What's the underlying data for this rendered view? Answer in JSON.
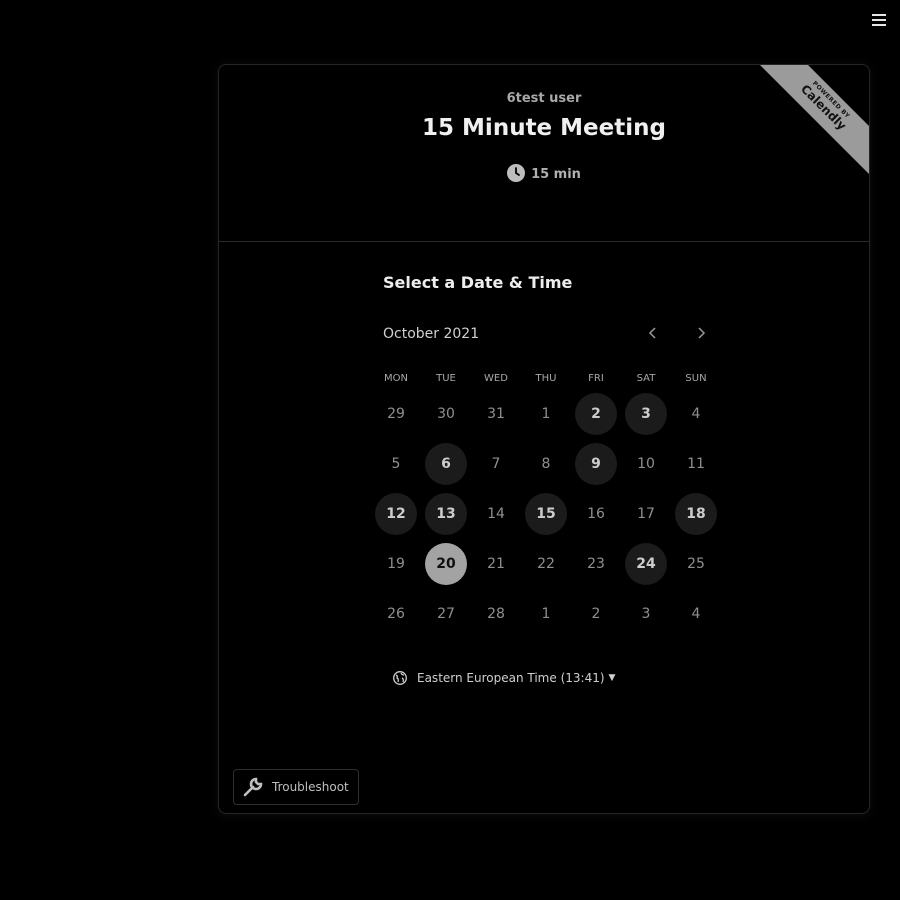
{
  "badge": {
    "powered_by": "POWERED BY",
    "brand": "Calendly"
  },
  "header": {
    "organizer": "6test user",
    "event_name": "15 Minute Meeting",
    "duration": "15 min"
  },
  "calendar": {
    "section_title": "Select a Date & Time",
    "month_label": "October 2021",
    "weekdays": [
      "MON",
      "TUE",
      "WED",
      "THU",
      "FRI",
      "SAT",
      "SUN"
    ],
    "weeks": [
      [
        {
          "day": "29",
          "state": "disabled"
        },
        {
          "day": "30",
          "state": "disabled"
        },
        {
          "day": "31",
          "state": "disabled"
        },
        {
          "day": "1",
          "state": "disabled"
        },
        {
          "day": "2",
          "state": "available"
        },
        {
          "day": "3",
          "state": "available"
        },
        {
          "day": "4",
          "state": "disabled"
        }
      ],
      [
        {
          "day": "5",
          "state": "disabled"
        },
        {
          "day": "6",
          "state": "available"
        },
        {
          "day": "7",
          "state": "disabled"
        },
        {
          "day": "8",
          "state": "disabled"
        },
        {
          "day": "9",
          "state": "available"
        },
        {
          "day": "10",
          "state": "disabled"
        },
        {
          "day": "11",
          "state": "disabled"
        }
      ],
      [
        {
          "day": "12",
          "state": "available"
        },
        {
          "day": "13",
          "state": "available"
        },
        {
          "day": "14",
          "state": "disabled"
        },
        {
          "day": "15",
          "state": "available"
        },
        {
          "day": "16",
          "state": "disabled"
        },
        {
          "day": "17",
          "state": "disabled"
        },
        {
          "day": "18",
          "state": "available"
        }
      ],
      [
        {
          "day": "19",
          "state": "disabled"
        },
        {
          "day": "20",
          "state": "selected"
        },
        {
          "day": "21",
          "state": "disabled"
        },
        {
          "day": "22",
          "state": "disabled"
        },
        {
          "day": "23",
          "state": "disabled"
        },
        {
          "day": "24",
          "state": "available"
        },
        {
          "day": "25",
          "state": "disabled"
        }
      ],
      [
        {
          "day": "26",
          "state": "disabled"
        },
        {
          "day": "27",
          "state": "disabled"
        },
        {
          "day": "28",
          "state": "disabled"
        },
        {
          "day": "1",
          "state": "disabled"
        },
        {
          "day": "2",
          "state": "disabled"
        },
        {
          "day": "3",
          "state": "disabled"
        },
        {
          "day": "4",
          "state": "disabled"
        }
      ]
    ]
  },
  "timezone": {
    "label": "Eastern European Time (13:41)"
  },
  "footer": {
    "troubleshoot_label": "Troubleshoot"
  },
  "icons": {
    "menu": "menu-icon",
    "clock": "clock-icon",
    "prev": "chevron-left-icon",
    "next": "chevron-right-icon",
    "globe": "globe-icon",
    "caret": "caret-down-icon",
    "wrench": "wrench-icon"
  },
  "colors": {
    "background": "#000000",
    "selected_day": "#a3a3a3",
    "available_day": "#1b1b1b"
  }
}
